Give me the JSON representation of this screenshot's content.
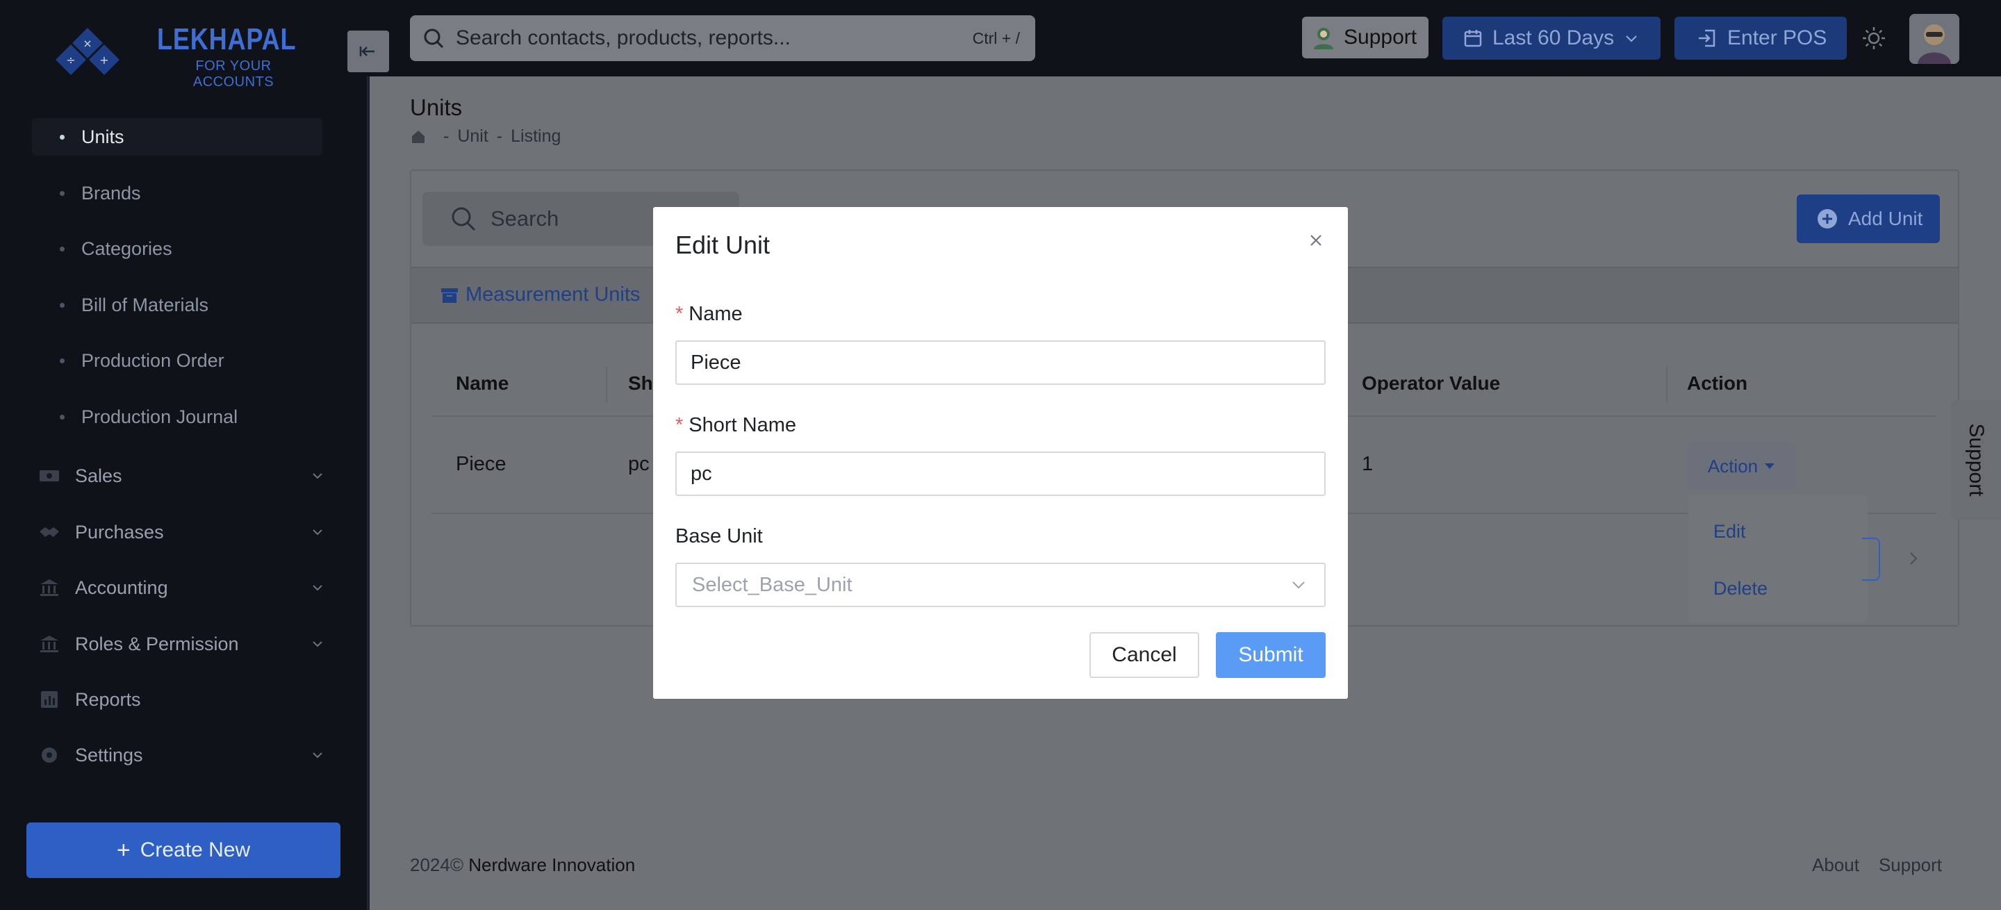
{
  "brand": {
    "name": "LEKHAPAL",
    "tagline": "FOR YOUR ACCOUNTS"
  },
  "topbar": {
    "search_placeholder": "Search contacts, products, reports...",
    "search_shortcut": "Ctrl + /",
    "support_label": "Support",
    "date_range_label": "Last 60 Days",
    "pos_label": "Enter POS"
  },
  "sidebar": {
    "sub_items": [
      {
        "label": "Units",
        "active": true
      },
      {
        "label": "Brands",
        "active": false
      },
      {
        "label": "Categories",
        "active": false
      },
      {
        "label": "Bill of Materials",
        "active": false
      },
      {
        "label": "Production Order",
        "active": false
      },
      {
        "label": "Production Journal",
        "active": false
      }
    ],
    "groups": [
      {
        "label": "Sales",
        "icon": "cash-icon"
      },
      {
        "label": "Purchases",
        "icon": "handshake-icon"
      },
      {
        "label": "Accounting",
        "icon": "bank-icon"
      },
      {
        "label": "Roles & Permission",
        "icon": "bank-icon"
      },
      {
        "label": "Reports",
        "icon": "chart-icon"
      },
      {
        "label": "Settings",
        "icon": "gear-icon"
      }
    ],
    "create_label": "Create New"
  },
  "page": {
    "title": "Units",
    "breadcrumb": [
      "Unit",
      "Listing"
    ],
    "search_placeholder": "Search",
    "add_label": "Add Unit",
    "tab_label": "Measurement Units",
    "table": {
      "headers": [
        "Name",
        "Sh",
        "Operator Value",
        "Action"
      ],
      "rows": [
        {
          "name": "Piece",
          "short": "pc",
          "operator_value": "1",
          "action": "Action"
        }
      ]
    },
    "action_menu": [
      "Edit",
      "Delete"
    ]
  },
  "support_tab": "Support",
  "footer": {
    "year": "2024©",
    "company": "Nerdware Innovation",
    "links": [
      "About",
      "Support"
    ]
  },
  "modal": {
    "title": "Edit Unit",
    "name_label": "Name",
    "name_value": "Piece",
    "short_label": "Short Name",
    "short_value": "pc",
    "base_label": "Base Unit",
    "base_placeholder": "Select_Base_Unit",
    "cancel_label": "Cancel",
    "submit_label": "Submit"
  },
  "colors": {
    "primary": "#2d5fc4",
    "submit": "#5a9cf5",
    "required": "#e25c5c",
    "sidebar_bg": "#0f1219"
  }
}
